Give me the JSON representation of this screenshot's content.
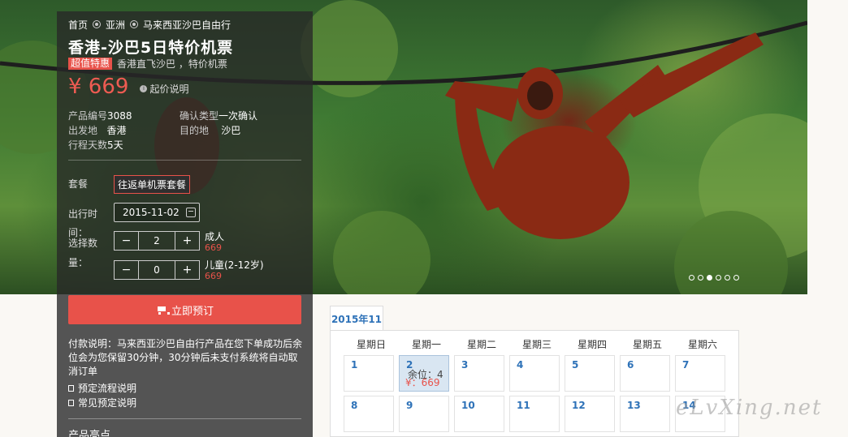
{
  "breadcrumb": [
    "首页",
    "亚洲",
    "马来西亚沙巴自由行"
  ],
  "title": "香港-沙巴5日特价机票",
  "badge": "超值特惠",
  "tagline": "香港直飞沙巴 ，特价机票",
  "price": "¥ 669",
  "price_note": "起价说明",
  "info": {
    "product_no_label": "产品编号",
    "product_no": "3088",
    "confirm_label": "确认类型",
    "confirm": "一次确认",
    "depart_label": "出发地",
    "depart": "香港",
    "dest_label": "目的地",
    "dest": "沙巴",
    "days_label": "行程天数",
    "days": "5天"
  },
  "form": {
    "package_label": "套餐",
    "package_value": "往返单机票套餐",
    "date_label": "出行时",
    "date_label2": "间：",
    "date_value": "2015-11-02",
    "qty_label": "选择数",
    "qty_label2": "量：",
    "adult_qty": "2",
    "adult_label": "成人",
    "adult_price": "669",
    "child_qty": "0",
    "child_label": "儿童(2-12岁)",
    "child_price": "669",
    "minus": "−",
    "plus": "+"
  },
  "book_button": "立即预订",
  "pay_note": "付款说明：马来西亚沙巴自由行产品在您下单成功后余位会为您保留30分钟，30分钟后未支付系统将自动取消订单",
  "links": [
    "预定流程说明",
    "常见预定说明"
  ],
  "highlights_label": "产品亮点",
  "slider_dots": 6,
  "calendar": {
    "tab": "2015年11",
    "weekdays": [
      "星期日",
      "星期一",
      "星期二",
      "星期三",
      "星期四",
      "星期五",
      "星期六"
    ],
    "row1": [
      "1",
      "2",
      "3",
      "4",
      "5",
      "6",
      "7"
    ],
    "row2": [
      "8",
      "9",
      "10",
      "11",
      "12",
      "13",
      "14"
    ],
    "selected_remaining": "余位：4",
    "selected_price": "¥：669"
  },
  "watermark": "eLvXing.net",
  "colors": {
    "accent": "#e8524a",
    "link": "#2e72b8"
  }
}
